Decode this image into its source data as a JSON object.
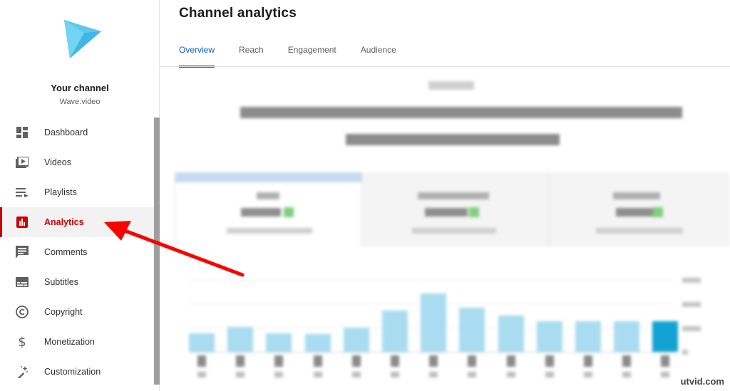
{
  "sidebar": {
    "channel_name": "Your channel",
    "channel_handle": "Wave.video",
    "items": [
      {
        "label": "Dashboard",
        "icon": "dashboard-icon"
      },
      {
        "label": "Videos",
        "icon": "videos-icon"
      },
      {
        "label": "Playlists",
        "icon": "playlists-icon"
      },
      {
        "label": "Analytics",
        "icon": "analytics-icon",
        "active": true
      },
      {
        "label": "Comments",
        "icon": "comments-icon"
      },
      {
        "label": "Subtitles",
        "icon": "subtitles-icon"
      },
      {
        "label": "Copyright",
        "icon": "copyright-icon"
      },
      {
        "label": "Monetization",
        "icon": "monetization-icon"
      },
      {
        "label": "Customization",
        "icon": "customization-icon"
      }
    ]
  },
  "main": {
    "title": "Channel analytics",
    "tabs": [
      {
        "label": "Overview",
        "active": true
      },
      {
        "label": "Reach"
      },
      {
        "label": "Engagement"
      },
      {
        "label": "Audience"
      }
    ]
  },
  "chart": {
    "bar_levels": [
      0.32,
      0.43,
      0.32,
      0.3,
      0.42,
      0.71,
      1.0,
      0.75,
      0.62,
      0.52,
      0.52,
      0.52,
      0.52
    ],
    "highlight_index": 12
  },
  "colors": {
    "accent_red": "#cc0000",
    "tab_blue": "#065fd4",
    "bar": "#a9dcf0",
    "bar_highlight": "#12a3d2",
    "arrow": "#ff0000"
  },
  "watermark": "utvid.com"
}
